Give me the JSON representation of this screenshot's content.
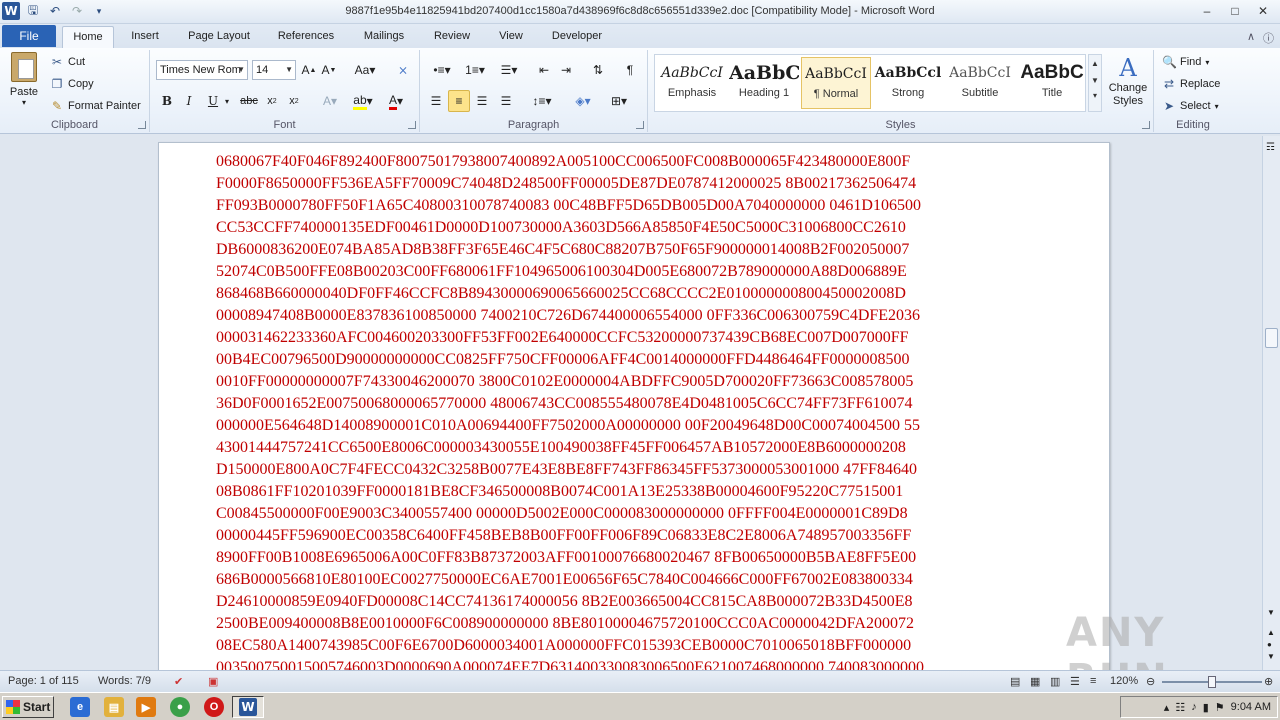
{
  "window": {
    "title": "9887f1e95b4e11825941bd207400d1cc1580a7d438969f6c8d8c656551d339e2.doc [Compatibility Mode] - Microsoft Word"
  },
  "tabs": {
    "file": "File",
    "items": [
      "Home",
      "Insert",
      "Page Layout",
      "References",
      "Mailings",
      "Review",
      "View",
      "Developer"
    ],
    "active": "Home"
  },
  "clipboard": {
    "paste": "Paste",
    "cut": "Cut",
    "copy": "Copy",
    "format_painter": "Format Painter",
    "label": "Clipboard"
  },
  "font": {
    "family": "Times New Rom",
    "size": "14",
    "label": "Font"
  },
  "paragraph": {
    "label": "Paragraph"
  },
  "styles": {
    "label": "Styles",
    "items": [
      {
        "sample": "AaBbCcI",
        "name": "Emphasis"
      },
      {
        "sample": "AaBbC",
        "name": "Heading 1"
      },
      {
        "sample": "AaBbCcI",
        "name": "¶ Normal"
      },
      {
        "sample": "AaBbCcl",
        "name": "Strong"
      },
      {
        "sample": "AaBbCcI",
        "name": "Subtitle"
      },
      {
        "sample": "AaBbC",
        "name": "Title"
      }
    ],
    "change_styles": "Change Styles"
  },
  "editing": {
    "find": "Find",
    "replace": "Replace",
    "select": "Select",
    "label": "Editing"
  },
  "document": {
    "lines": [
      "0680067F40F046F892400F80075017938007400892A005100CC006500FC008B000065F423480000E800F",
      "F0000F8650000FF536EA5FF70009C74048D248500FF00005DE87DE0787412000025 8B00217362506474",
      "FF093B0000780FF50F1A65C40800310078740083 00C48BFF5D65DB005D00A7040000000 0461D106500",
      "CC53CCFF740000135EDF00461D0000D100730000A3603D566A85850F4E50C5000C31006800CC2610",
      "DB6000836200E074BA85AD8B38FF3F65E46C4F5C680C88207B750F65F900000014008B2F002050007",
      "52074C0B500FFE08B00203C00FF680061FF104965006100304D005E680072B789000000A88D006889E",
      "868468B660000040DF0FF46CCFC8B89430000690065660025CC68CCCC2E010000000800450002008D",
      "00008947408B0000E837836100850000 7400210C726D674400006554000 0FF336C006300759C4DFE2036",
      "000031462233360AFC004600203300FF53FF002E640000CCFC53200000737439CB68EC007D007000FF",
      "00B4EC00796500D90000000000CC0825FF750CFF00006AFF4C0014000000FFD4486464FF0000008500",
      "0010FF00000000007F74330046200070 3800C0102E0000004ABDFFC9005D700020FF73663C008578005",
      "36D0F0001652E00750068000065770000 48006743CC008555480078E4D0481005C6CC74FF73FF610074",
      "000000E564648D14008900001C010A00694400FF7502000A00000000 00F20049648D00C00074004500 55",
      "43001444757241CC6500E8006C000003430055E100490038FF45FF006457AB10572000E8B6000000208",
      "D150000E800A0C7F4FECC0432C3258B0077E43E8BE8FF743FF86345FF5373000053001000 47FF84640",
      "08B0861FF10201039FF0000181BE8CF346500008B0074C001A13E25338B00004600F95220C77515001",
      "C00845500000F00E9003C3400557400 00000D5002E000C000083000000000 0FFFF004E0000001C89D8",
      "00000445FF596900EC00358C6400FF458BEB8B00FF00FF006F89C06833E8C2E8006A748957003356FF",
      "8900FF00B1008E6965006A00C0FF83B87372003AFF00100076680020467 8FB00650000B5BAE8FF5E00",
      "686B0000566810E80100EC0027750000EC6AE7001E00656F65C7840C004666C000FF67002E083800334",
      "D24610000859E0940FD00008C14CC74136174000056 8B2E003665004CC815CA8B000072B33D4500E8",
      "2500BE009400008B8E0010000F6C008900000000 8BE80100004675720100CCC0AC0000042DFA200072",
      "08EC580A1400743985C00F6E6700D6000034001A000000FFC015393CEB0000C7010065018BFF000000",
      "003500750015005746003D0000690A000074EE7D631400330083006500E621007468000000 740083000000"
    ]
  },
  "statusbar": {
    "page": "Page: 1 of 115",
    "words": "Words: 7/9",
    "zoom": "120%"
  },
  "taskbar": {
    "start": "Start",
    "time": "9:04 AM"
  },
  "watermark": "ANY RUN"
}
